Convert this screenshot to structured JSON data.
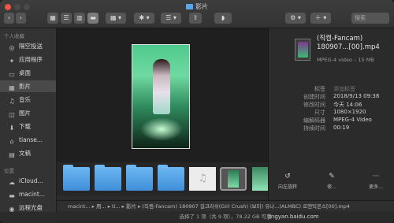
{
  "window": {
    "title": "影片"
  },
  "sidebar": {
    "section_favorites": "个人收藏",
    "favorites": [
      {
        "label": "隔空投送",
        "icon": "airdrop-icon",
        "glyph": "◎"
      },
      {
        "label": "应用程序",
        "icon": "applications-icon",
        "glyph": "✦"
      },
      {
        "label": "桌面",
        "icon": "desktop-icon",
        "glyph": "▭"
      },
      {
        "label": "影片",
        "icon": "movies-icon",
        "glyph": "▦"
      },
      {
        "label": "音乐",
        "icon": "music-icon",
        "glyph": "♫"
      },
      {
        "label": "图片",
        "icon": "pictures-icon",
        "glyph": "◫"
      },
      {
        "label": "下载",
        "icon": "downloads-icon",
        "glyph": "⬇"
      },
      {
        "label": "tianse...",
        "icon": "home-icon",
        "glyph": "⌂"
      },
      {
        "label": "文稿",
        "icon": "documents-icon",
        "glyph": "▤"
      }
    ],
    "section_locations": "位置",
    "locations": [
      {
        "label": "iCloud...",
        "icon": "cloud-icon",
        "glyph": "☁"
      },
      {
        "label": "macint...",
        "icon": "disk-icon",
        "glyph": "▬"
      },
      {
        "label": "远程光盘",
        "icon": "remote-disc-icon",
        "glyph": "◉"
      }
    ]
  },
  "toolbar": {
    "back": "‹",
    "forward": "›",
    "view_icon": "▦",
    "view_list": "☰",
    "view_column": "▥",
    "view_gallery": "▬",
    "group": "▦ ▾",
    "action": "✱ ▾",
    "arrange": "☰ ▾",
    "share": "⇪",
    "tag": "◗",
    "search_placeholder": "搜索"
  },
  "info": {
    "name": "(직캠-Fancam) 180907...[00].mp4",
    "kind": "MPEG-4 video – 15 MB",
    "meta": [
      {
        "k": "标签",
        "v": "添加标签",
        "placeholder": true
      },
      {
        "k": "创建时间",
        "v": "2018/9/13 09:38"
      },
      {
        "k": "修改时间",
        "v": "今天 14:06"
      },
      {
        "k": "尺寸",
        "v": "1080×1920"
      },
      {
        "k": "编解码器",
        "v": "MPEG-4 Video"
      },
      {
        "k": "持续时间",
        "v": "00:19"
      }
    ],
    "actions": [
      {
        "label": "向左旋转",
        "glyph": "↺"
      },
      {
        "label": "修...",
        "glyph": "✎"
      },
      {
        "label": "更多...",
        "glyph": "···"
      }
    ]
  },
  "pathbar": "macint... ▸ 用... ▸ ti... ▸ 影片 ▸ (직캠-Fancam) 180907 걸크러쉬(Girl Crush) (보미) 유나...(ALMBC) 로맨틱몬스[00].mp4",
  "statusbar": "选择了 1 项（共 9 项），78.22 GB 可用",
  "watermark": "jingyan.baidu.com",
  "thumbs_music_glyph": "♫"
}
